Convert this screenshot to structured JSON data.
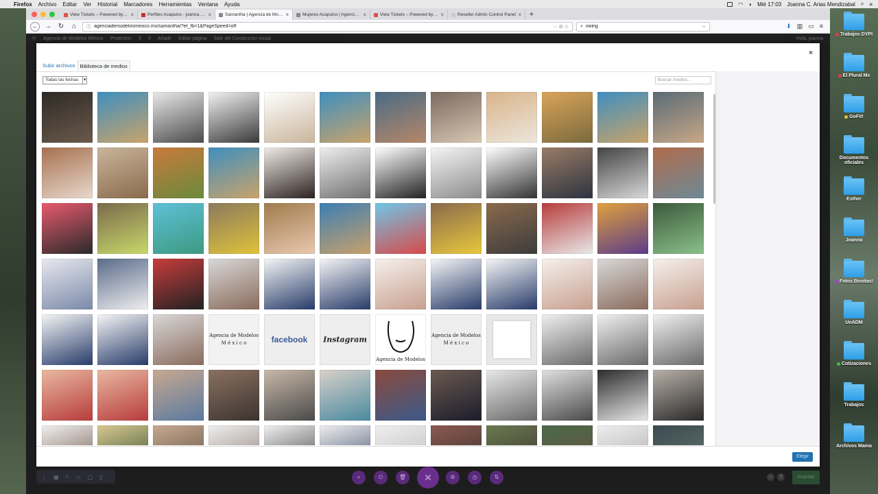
{
  "menubar": {
    "app_name": "Firefox",
    "items": [
      "Archivo",
      "Editar",
      "Ver",
      "Historial",
      "Marcadores",
      "Herramientas",
      "Ventana",
      "Ayuda"
    ],
    "clock": "Mié 17:03",
    "user": "Joanna C. Arias Mendizabal"
  },
  "tabs": [
    {
      "label": "View Tickets – Powered by Kay",
      "color": "#d9534f"
    },
    {
      "label": "Perfiles Acapulco - joanna.arias",
      "color": "#c9302c"
    },
    {
      "label": "Samantha | Agencia de Modelos",
      "color": "#888888",
      "active": true
    },
    {
      "label": "Mujeres Acapulco | Agencia de",
      "color": "#888888"
    },
    {
      "label": "View Tickets – Powered by Kay",
      "color": "#d9534f"
    },
    {
      "label": "Reseller Admin Control Panel",
      "color": "#cccccc"
    }
  ],
  "navbar": {
    "url": "agenciademodelosmexico.mx/samantha/?et_fb=1&PageSpeed=off",
    "url_actions": "··· ⊙ ☆",
    "search_value": "vwing"
  },
  "wpbar": {
    "items": [
      "Agencia de Modelos México",
      "Protection",
      "5",
      "0",
      "Añadir",
      "Editar página",
      "Salir del Constructor visual"
    ],
    "greeting": "Hola, joanna"
  },
  "modal": {
    "close": "×",
    "tab_upload": "Subir archivos",
    "tab_library": "Biblioteca de medios",
    "date_filter": "Todas las fechas",
    "search_placeholder": "Buscar medios...",
    "choose_button": "Elegir",
    "text_thumbs": {
      "agency_logo": "Agencia de Modelos\nM é x i c o",
      "facebook": "facebook",
      "instagram": "Instagram",
      "agency_logo_face": "Agencia de Modelos",
      "agency_logo_2": "Agencia de Modelos\nM é x i c o"
    }
  },
  "builder": {
    "save_label": "Guardar",
    "help": "?"
  },
  "desktop": [
    {
      "label": "Trabajos DYPI",
      "tag": "#e04040"
    },
    {
      "label": "El Plural Mx",
      "tag": "#e04040"
    },
    {
      "label": "GoFit!",
      "tag": "#e0c040"
    },
    {
      "label": "Documentos oficiales",
      "tag": ""
    },
    {
      "label": "Esther",
      "tag": ""
    },
    {
      "label": "Joanna",
      "tag": ""
    },
    {
      "label": "Fotos Bonitas!",
      "tag": "#a040e0"
    },
    {
      "label": "UnADM",
      "tag": ""
    },
    {
      "label": "Cotizaciones",
      "tag": "#40c040"
    },
    {
      "label": "Trabajos",
      "tag": ""
    },
    {
      "label": "Archivos Mama",
      "tag": ""
    }
  ]
}
